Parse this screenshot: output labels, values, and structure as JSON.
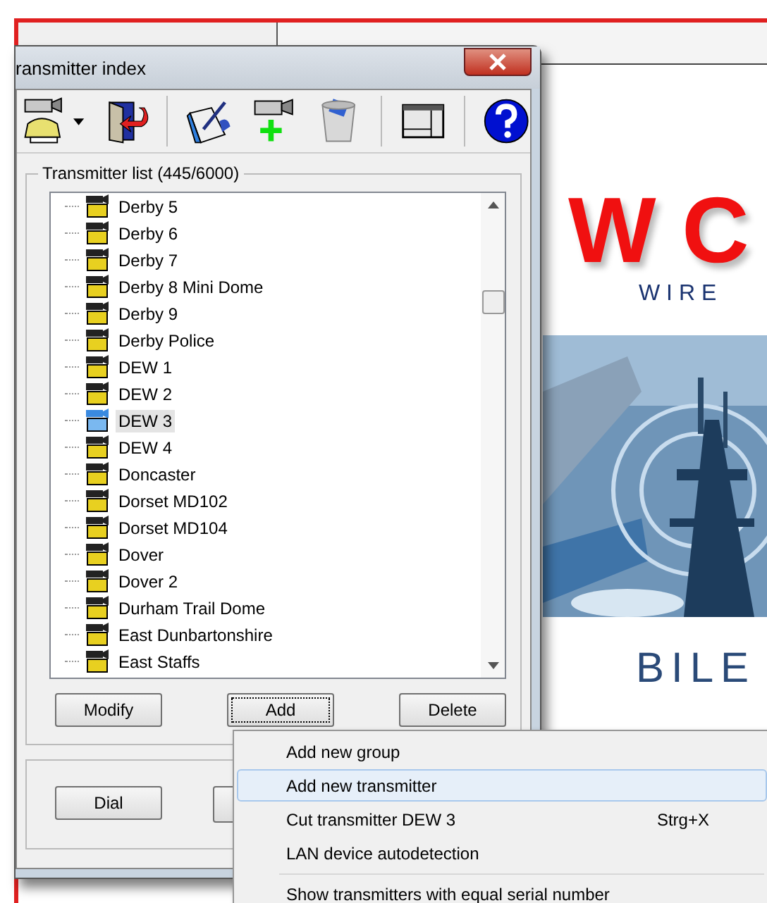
{
  "window": {
    "title": "ransmitter index"
  },
  "toolbar": [
    {
      "kind": "camera-phone"
    },
    {
      "kind": "dropdown"
    },
    {
      "kind": "door"
    },
    {
      "kind": "sep"
    },
    {
      "kind": "notebook"
    },
    {
      "kind": "camera-add"
    },
    {
      "kind": "trash"
    },
    {
      "kind": "sep"
    },
    {
      "kind": "window"
    },
    {
      "kind": "sep"
    },
    {
      "kind": "help"
    }
  ],
  "transmitter_list": {
    "title": "Transmitter list (445/6000)",
    "items": [
      {
        "name": "Derby 5",
        "selected": false
      },
      {
        "name": "Derby 6",
        "selected": false
      },
      {
        "name": "Derby 7",
        "selected": false
      },
      {
        "name": "Derby 8 Mini Dome",
        "selected": false
      },
      {
        "name": "Derby 9",
        "selected": false
      },
      {
        "name": "Derby Police",
        "selected": false
      },
      {
        "name": "DEW 1",
        "selected": false
      },
      {
        "name": "DEW 2",
        "selected": false
      },
      {
        "name": "DEW 3",
        "selected": true
      },
      {
        "name": "DEW 4",
        "selected": false
      },
      {
        "name": "Doncaster",
        "selected": false
      },
      {
        "name": "Dorset MD102",
        "selected": false
      },
      {
        "name": "Dorset MD104",
        "selected": false
      },
      {
        "name": "Dover",
        "selected": false
      },
      {
        "name": "Dover 2",
        "selected": false
      },
      {
        "name": "Durham Trail Dome",
        "selected": false
      },
      {
        "name": "East Dunbartonshire",
        "selected": false
      },
      {
        "name": "East Staffs",
        "selected": false
      }
    ],
    "buttons": [
      {
        "label": "Modify",
        "focused": false
      },
      {
        "label": "Add",
        "focused": true
      },
      {
        "label": "Delete",
        "focused": false
      }
    ]
  },
  "bottom_buttons": [
    {
      "label": "Dial"
    }
  ],
  "splash": {
    "logo": "W C",
    "tagline": "W I R E",
    "footer": "BILE"
  },
  "context_menu": [
    {
      "kind": "item",
      "label": "Add new group",
      "selected": false
    },
    {
      "kind": "item",
      "label": "Add new transmitter",
      "selected": true
    },
    {
      "kind": "item",
      "label": "Cut transmitter DEW 3",
      "shortcut": "Strg+X",
      "selected": false
    },
    {
      "kind": "item",
      "label": "LAN device autodetection",
      "selected": false
    },
    {
      "kind": "separator"
    },
    {
      "kind": "item",
      "label": "Show transmitters with equal serial number",
      "selected": false
    }
  ]
}
